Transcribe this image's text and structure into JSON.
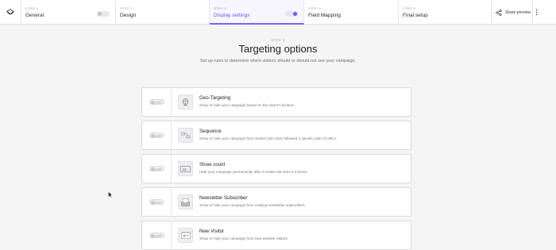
{
  "stepper": {
    "steps": [
      {
        "num": "STEP 1",
        "title": "General"
      },
      {
        "num": "STEP 2",
        "title": "Design"
      },
      {
        "num": "STEP 3",
        "title": "Display settings"
      },
      {
        "num": "STEP 4",
        "title": "Field Mapping"
      },
      {
        "num": "STEP 5",
        "title": "Final setup"
      }
    ],
    "share_label": "Share preview"
  },
  "header": {
    "eyebrow": "STEP 3",
    "title": "Targeting options",
    "subtitle": "Set up rules to determine which visitors should or should not see your campaign."
  },
  "cards": [
    {
      "state": "OFF",
      "title": "Geo-Targeting",
      "desc": "Show or hide your campaign based on the visitor's location.",
      "icon": "globe-icon"
    },
    {
      "state": "OFF",
      "title": "Sequence",
      "desc": "Show or hide your campaign from visitors who have followed a specific path of URLs.",
      "icon": "sequence-icon"
    },
    {
      "state": "OFF",
      "title": "Show count",
      "desc": "Hide your campaign permanently after a visitor has seen it X times.",
      "icon": "counter-icon"
    },
    {
      "state": "OFF",
      "title": "Newsletter Subscriber",
      "desc": "Show or hide your campaign from existing newsletter subscribers.",
      "icon": "envelope-icon"
    },
    {
      "state": "OFF",
      "title": "New Visitor",
      "desc": "Show or hide your campaign from new website visitors.",
      "icon": "new-visitor-icon"
    }
  ],
  "colors": {
    "accent": "#6a5ce8",
    "background": "#f5f5f6"
  }
}
